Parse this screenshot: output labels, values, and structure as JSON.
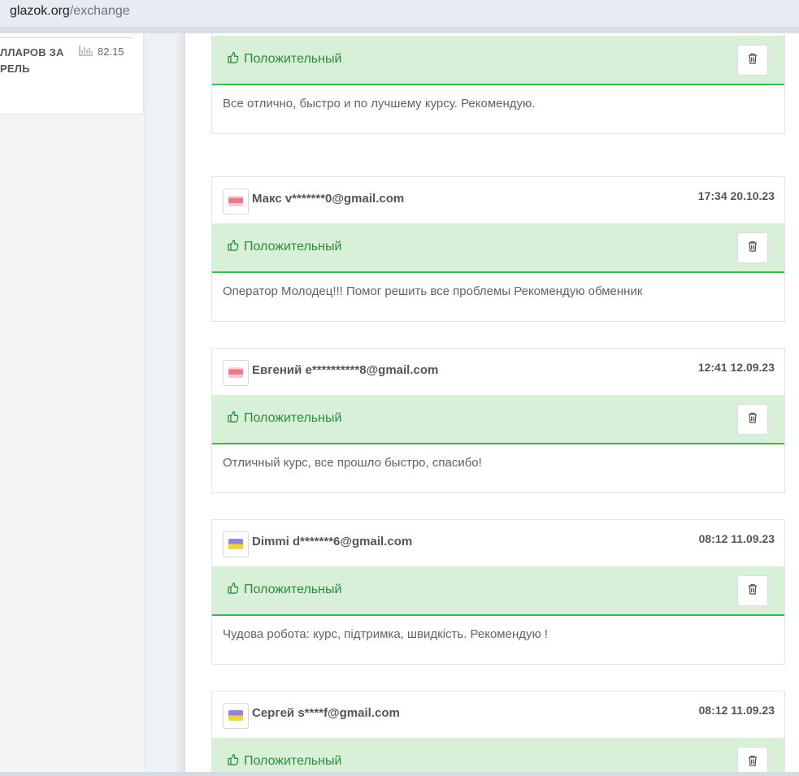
{
  "browser": {
    "host": "glazok.org",
    "path": "/exchange"
  },
  "sidebar": {
    "card": {
      "title": "ЛЛАРОВ ЗА РЕЛЬ",
      "stat_value": "82.15",
      "stat_icon": "bar-chart-icon"
    }
  },
  "reviews": [
    {
      "name": "",
      "time": "",
      "flag": "ru",
      "status": "Положительный",
      "text": "Все отлично, быстро и по лучшему курсу. Рекомендую."
    },
    {
      "name": "Макс v*******0@gmail.com",
      "time": "17:34 20.10.23",
      "flag": "ru",
      "status": "Положительный",
      "text": "Оператор Молодец!!! Помог решить все проблемы Рекомендую обменник"
    },
    {
      "name": "Евгений e**********8@gmail.com",
      "time": "12:41 12.09.23",
      "flag": "ru",
      "status": "Положительный",
      "text": "Отличный курс, все прошло быстро, спасибо!"
    },
    {
      "name": "Dimmi d*******6@gmail.com",
      "time": "08:12 11.09.23",
      "flag": "ua",
      "status": "Положительный",
      "text": "Чудова робота: курс, підтримка, швидкість. Рекомендую !"
    },
    {
      "name": "Сергей s****f@gmail.com",
      "time": "08:12 11.09.23",
      "flag": "ua",
      "status": "Положительный",
      "text": ""
    }
  ],
  "colors": {
    "positive_bg": "#d9f0d8",
    "positive_text": "#2a8a3e",
    "positive_border": "#2ec04a"
  }
}
